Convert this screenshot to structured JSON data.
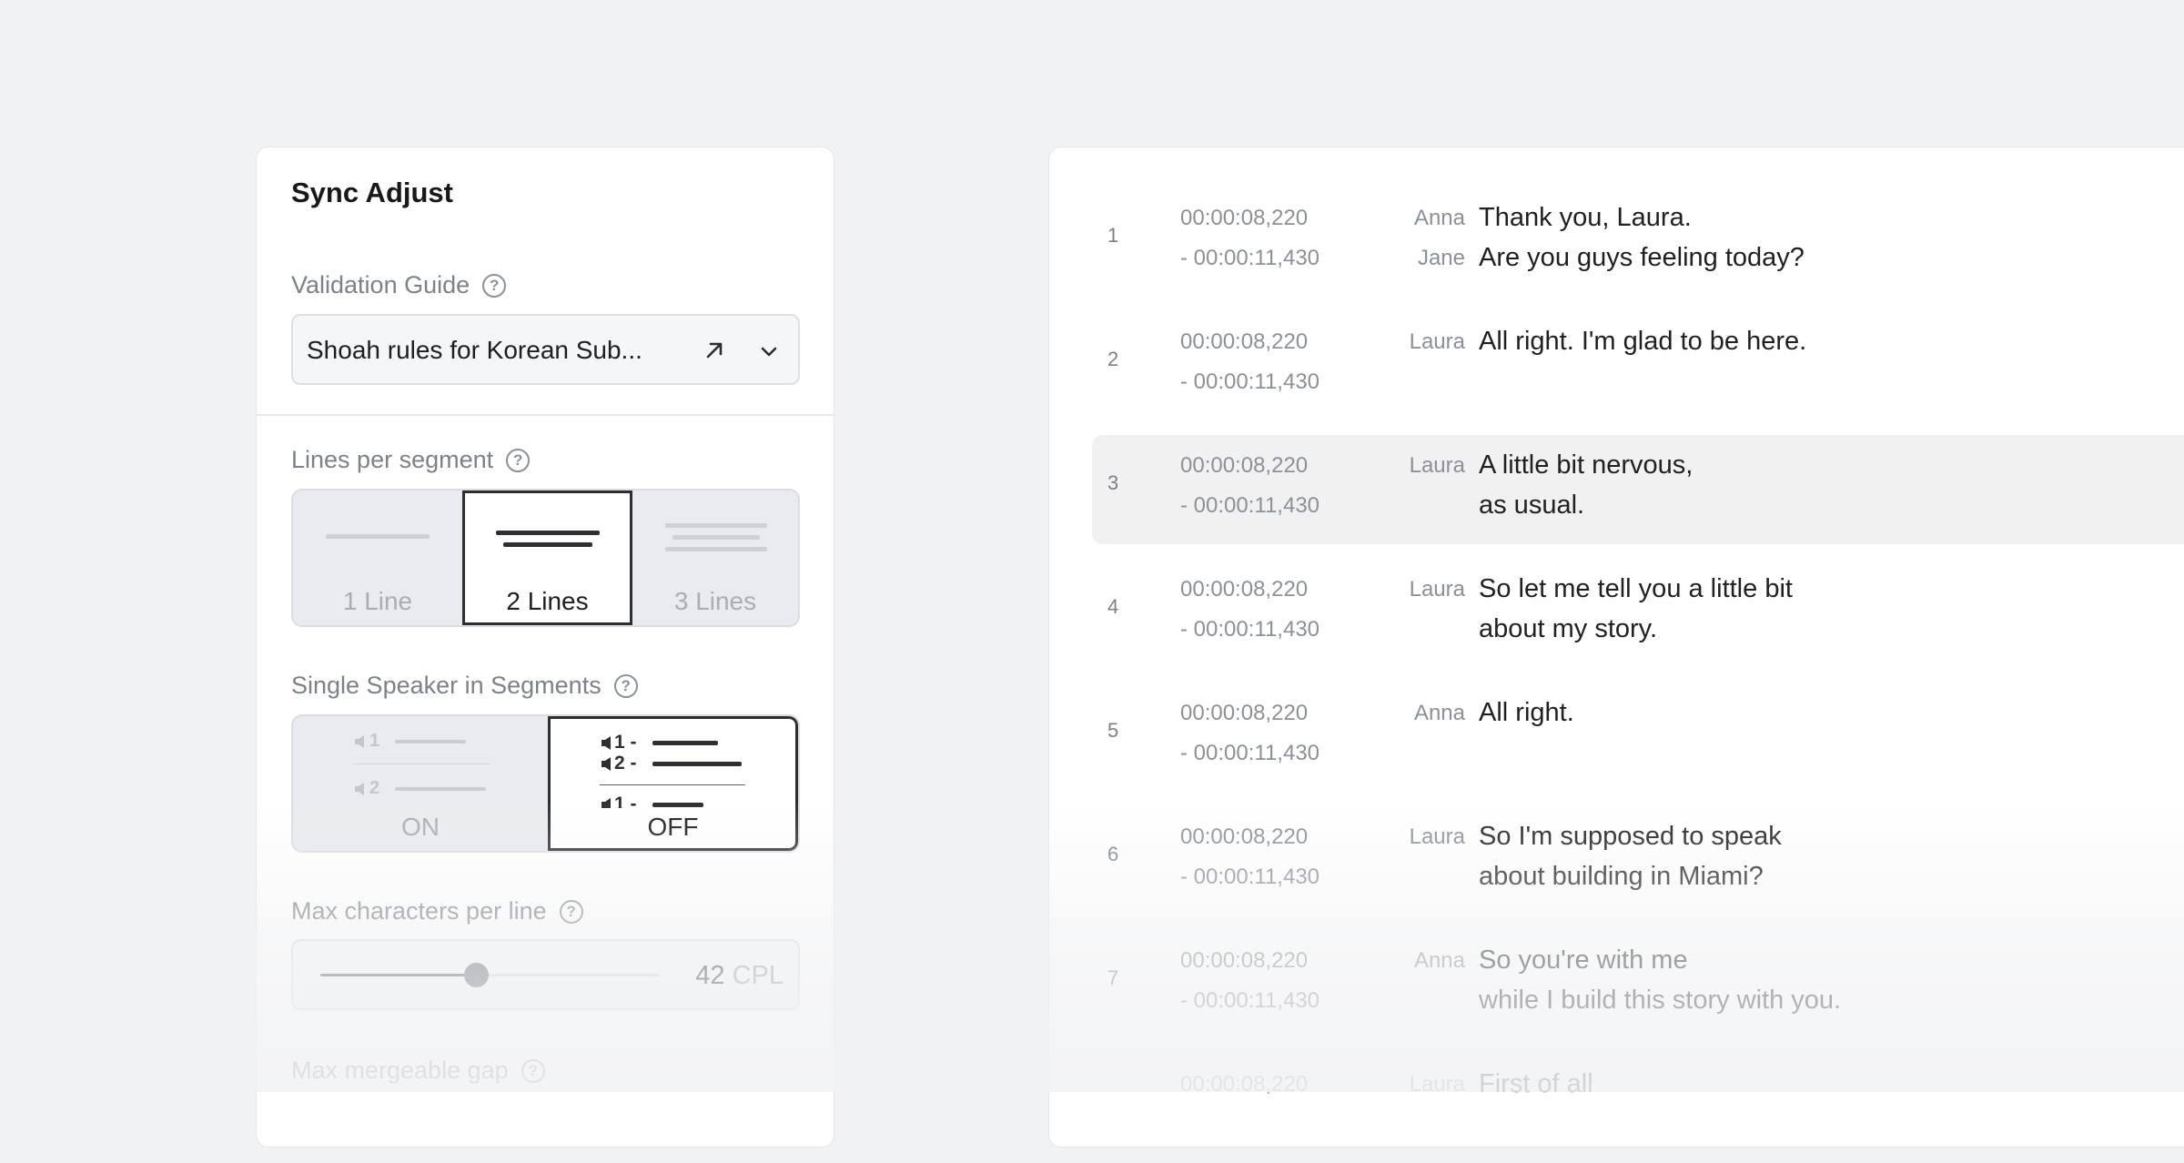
{
  "left_panel": {
    "title": "Sync Adjust",
    "validation_guide": {
      "label": "Validation Guide",
      "help": "?",
      "selected": "Shoah rules for Korean Sub..."
    },
    "lines_per_segment": {
      "label": "Lines per segment",
      "help": "?",
      "options": [
        "1 Line",
        "2 Lines",
        "3 Lines"
      ],
      "selected": "2 Lines"
    },
    "single_speaker": {
      "label": "Single Speaker in Segments",
      "help": "?",
      "options": [
        "ON",
        "OFF"
      ],
      "selected": "OFF",
      "illustration_on": [
        "1",
        "2"
      ],
      "illustration_off": [
        "1 -",
        "2 -",
        "1 -"
      ]
    },
    "max_chars": {
      "label": "Max characters per line",
      "help": "?",
      "value": "42",
      "unit": "CPL",
      "slider_fraction": 0.46
    },
    "max_gap": {
      "label": "Max mergeable gap",
      "help": "?"
    }
  },
  "segments": [
    {
      "num": "1",
      "start": "00:00:08,220",
      "end": "- 00:00:11,430",
      "speakers": [
        "Anna",
        "Jane"
      ],
      "lines": [
        "Thank you, Laura.",
        "Are you guys feeling today?"
      ]
    },
    {
      "num": "2",
      "start": "00:00:08,220",
      "end": "- 00:00:11,430",
      "speakers": [
        "Laura"
      ],
      "lines": [
        "All right. I'm glad to be here."
      ]
    },
    {
      "num": "3",
      "start": "00:00:08,220",
      "end": "- 00:00:11,430",
      "speakers": [
        "Laura"
      ],
      "lines": [
        "A little bit nervous,",
        "as usual."
      ]
    },
    {
      "num": "4",
      "start": "00:00:08,220",
      "end": "- 00:00:11,430",
      "speakers": [
        "Laura"
      ],
      "lines": [
        "So let me tell you a little bit",
        "about my story."
      ]
    },
    {
      "num": "5",
      "start": "00:00:08,220",
      "end": "- 00:00:11,430",
      "speakers": [
        "Anna"
      ],
      "lines": [
        "All right."
      ]
    },
    {
      "num": "6",
      "start": "00:00:08,220",
      "end": "- 00:00:11,430",
      "speakers": [
        "Laura"
      ],
      "lines": [
        "So I'm supposed to speak",
        "about building in Miami?"
      ]
    },
    {
      "num": "7",
      "start": "00:00:08,220",
      "end": "- 00:00:11,430",
      "speakers": [
        "Anna"
      ],
      "lines": [
        "So you're with me",
        "while I build this story with you."
      ]
    },
    {
      "num": "",
      "start": "00:00:08,220",
      "end": "",
      "speakers": [
        "Laura"
      ],
      "lines": [
        "First of all"
      ]
    }
  ]
}
